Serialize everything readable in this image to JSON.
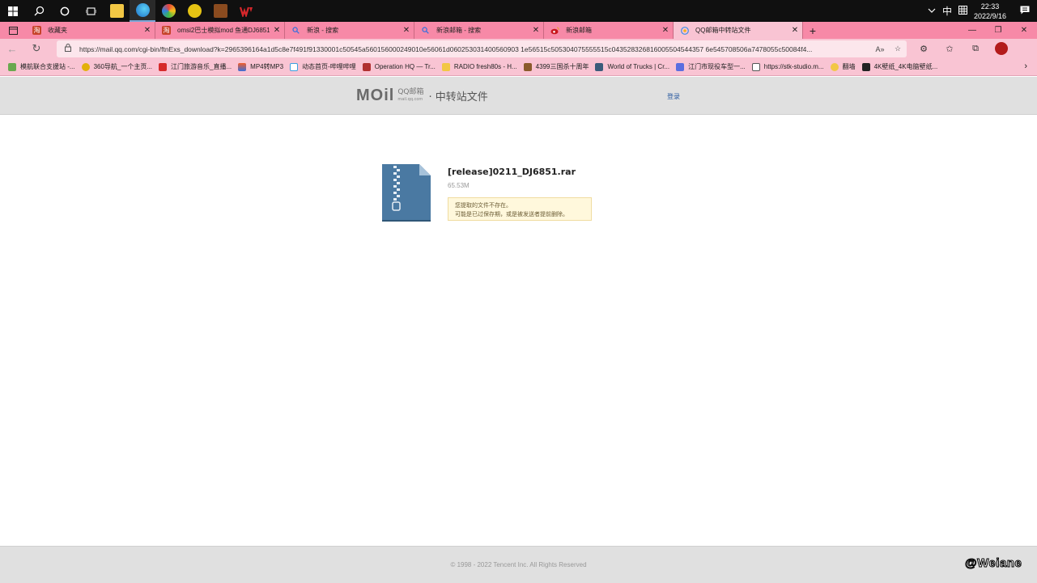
{
  "taskbar": {
    "apps": [
      {
        "name": "file-explorer",
        "color": "#f2c744"
      },
      {
        "name": "edge",
        "color": "#1e8fd6"
      },
      {
        "name": "360-browser",
        "color": "#3fb84a"
      },
      {
        "name": "speedrun-app",
        "color": "#e5c313"
      },
      {
        "name": "game-app",
        "color": "#8a4b1f"
      },
      {
        "name": "wps",
        "color": "#d7272b"
      }
    ],
    "ime": "中",
    "time": "22:33",
    "date": "2022/9/16"
  },
  "tabs": [
    {
      "title": "收藏夹",
      "fav_color": "#c7432a",
      "fav_glyph": "淘",
      "active": false
    },
    {
      "title": "omsi2巴士模拟mod 鱼通DJ6851",
      "fav_color": "#c7432a",
      "fav_glyph": "淘",
      "active": false
    },
    {
      "title": "新浪 - 搜索",
      "fav_color": "#2f6fe0",
      "fav_glyph": "🔍",
      "active": false
    },
    {
      "title": "新浪邮箱 - 搜索",
      "fav_color": "#2f6fe0",
      "fav_glyph": "🔍",
      "active": false
    },
    {
      "title": "新浪邮箱",
      "fav_color": "#c8161d",
      "fav_glyph": "◉",
      "active": false
    },
    {
      "title": "QQ邮箱中转站文件",
      "fav_color": "#3a8ee6",
      "fav_glyph": "◎",
      "active": true
    }
  ],
  "address": {
    "url": "https://mail.qq.com/cgi-bin/ftnExs_download?k=2965396164a1d5c8e7f491f91330001c50545a560156000249010e56061d060253031400560903 1e56515c505304075555515c043528326816005504544357 6e545708506a7478055c50084f4..."
  },
  "bookmarks": [
    {
      "label": "模航联合支援站 -...",
      "color": "#6aa84f"
    },
    {
      "label": "360导航_一个主页...",
      "color": "#e2b00a"
    },
    {
      "label": "江门旅游音乐_直播...",
      "color": "#d62b2b"
    },
    {
      "label": "MP4转MP3",
      "color": "#3b6fd8"
    },
    {
      "label": "动态首页-哔哩哔哩",
      "color": "#3aa0e0"
    },
    {
      "label": "Operation HQ — Tr...",
      "color": "#b03030"
    },
    {
      "label": "RADIO fresh80s - H...",
      "color": "#f2c744"
    },
    {
      "label": "4399三国杀十周年",
      "color": "#8a5a2b"
    },
    {
      "label": "World of Trucks | Cr...",
      "color": "#3b5b7a"
    },
    {
      "label": "江门市现役车型一...",
      "color": "#5b6ee0"
    },
    {
      "label": "https://stk-studio.m...",
      "color": "#ffffff"
    },
    {
      "label": "翻墙",
      "color": "#f2c744"
    },
    {
      "label": "4K壁纸_4K电脑壁纸...",
      "color": "#222222"
    }
  ],
  "header": {
    "logo_text": "MOil",
    "logo_qq": "QQ邮箱",
    "logo_domain": "mail.qq.com",
    "title": "· 中转站文件",
    "login_label": "登录"
  },
  "file": {
    "name": "[release]0211_DJ6851.rar",
    "size": "65.53M",
    "notice_line1": "您提取的文件不存在。",
    "notice_line2": "可能是已过保存期，或是被发送者提前删除。"
  },
  "footer": {
    "copyright": "© 1998 - 2022 Tencent Inc. All Rights Reserved"
  },
  "watermark": "@Weiane"
}
